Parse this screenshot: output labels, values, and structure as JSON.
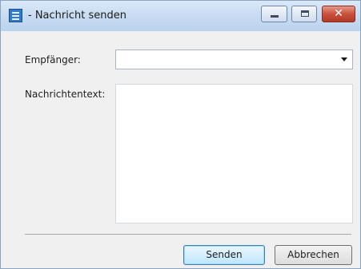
{
  "window": {
    "title": "- Nachricht senden",
    "icon": "list-document-icon"
  },
  "form": {
    "recipient_label": "Empfänger:",
    "recipient_value": "",
    "message_label": "Nachrichtentext:",
    "message_value": ""
  },
  "buttons": {
    "send_label": "Senden",
    "cancel_label": "Abbrechen"
  },
  "colors": {
    "titlebar": "#c6daf1",
    "close_button": "#c9503c",
    "default_button_border": "#3c7fb1"
  }
}
